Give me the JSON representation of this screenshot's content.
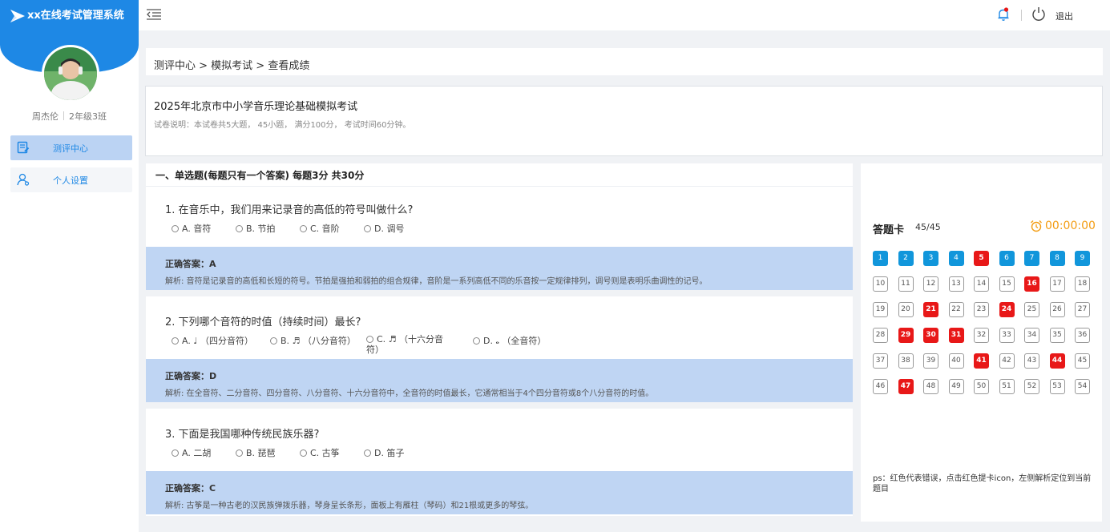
{
  "app": {
    "title": "xx在线考试管理系统",
    "user_name": "周杰伦",
    "user_class": "2年级3班"
  },
  "nav": [
    {
      "label": "测评中心",
      "icon": "edit-note-icon",
      "active": true
    },
    {
      "label": "个人设置",
      "icon": "user-settings-icon",
      "active": false
    }
  ],
  "topbar": {
    "logout_label": "退出"
  },
  "breadcrumb": "测评中心 > 模拟考试 > 查看成绩",
  "exam": {
    "title": "2025年北京市中小学音乐理论基础模拟考试",
    "desc": "试卷说明：本试卷共5大题， 45小题， 满分100分， 考试时间60分钟。"
  },
  "section": {
    "title": "一、单选题(每题只有一个答案) 每题3分 共30分"
  },
  "questions": [
    {
      "text": "1. 在音乐中，我们用来记录音的高低的符号叫做什么?",
      "options": [
        "A. 音符",
        "B. 节拍",
        "C. 音阶",
        "D. 调号"
      ],
      "answer_label": "正确答案：A",
      "explain": "解析: 音符是记录音的高低和长短的符号。节拍是强拍和弱拍的组合规律，音阶是一系列高低不同的乐音按一定规律排列，调号则是表明乐曲调性的记号。"
    },
    {
      "text": "2. 下列哪个音符的时值（持续时间）最长?",
      "options": [
        "A. ♩ （四分音符）",
        "B. ♬ （八分音符）",
        "C. ♬ （十六分音符）",
        "D. 𝅝 （全音符）"
      ],
      "answer_label": "正确答案：D",
      "explain": "解析: 在全音符、二分音符、四分音符、八分音符、十六分音符中，全音符的时值最长，它通常相当于4个四分音符或8个八分音符的时值。"
    },
    {
      "text": "3. 下面是我国哪种传统民族乐器?",
      "options": [
        "A. 二胡",
        "B. 琵琶",
        "C. 古筝",
        "D. 笛子"
      ],
      "answer_label": "正确答案：C",
      "explain": "解析: 古筝是一种古老的汉民族弹拨乐器，琴身呈长条形，面板上有雁柱（琴码）和21根或更多的琴弦。"
    }
  ],
  "card": {
    "title": "答题卡",
    "count": "45/45",
    "timer": "00:00:00",
    "answered": [
      1,
      2,
      3,
      4,
      6,
      7,
      8,
      9
    ],
    "wrong": [
      5,
      16,
      21,
      24,
      29,
      30,
      31,
      41,
      44,
      47
    ],
    "total": 54,
    "note": "ps：红色代表错误，点击红色提卡icon，左侧解析定位到当前题目",
    "colors": {
      "answered": "#1196db",
      "wrong": "#e81818",
      "timer": "#f39c12"
    }
  }
}
